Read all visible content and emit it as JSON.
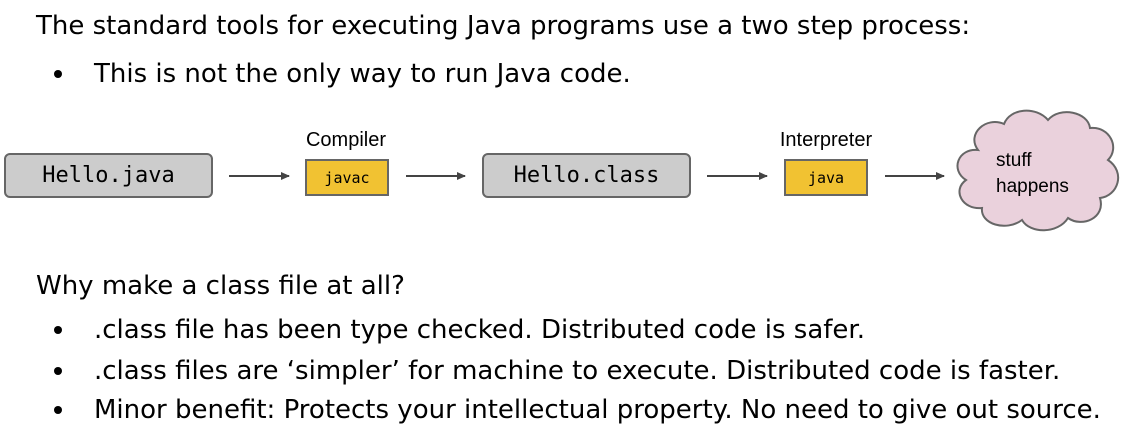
{
  "intro": {
    "heading": "The standard tools for executing Java programs use a two step process:",
    "bullets": [
      "This is not the only way to run Java code."
    ]
  },
  "diagram": {
    "source_file": "Hello.java",
    "compiler_label": "Compiler",
    "compiler_command": "javac",
    "class_file": "Hello.class",
    "interpreter_label": "Interpreter",
    "interpreter_command": "java",
    "result_line1": "stuff",
    "result_line2": "happens",
    "colors": {
      "file_box": "#cccccc",
      "tool_box": "#f1c232",
      "cloud": "#ead1dc",
      "border": "#666666"
    }
  },
  "why": {
    "heading": "Why make a class file at all?",
    "bullets": [
      ".class file has been type checked. Distributed code is safer.",
      ".class files are ‘simpler’ for machine to execute. Distributed code is faster.",
      "Minor benefit: Protects your intellectual property. No need to give out source."
    ]
  }
}
